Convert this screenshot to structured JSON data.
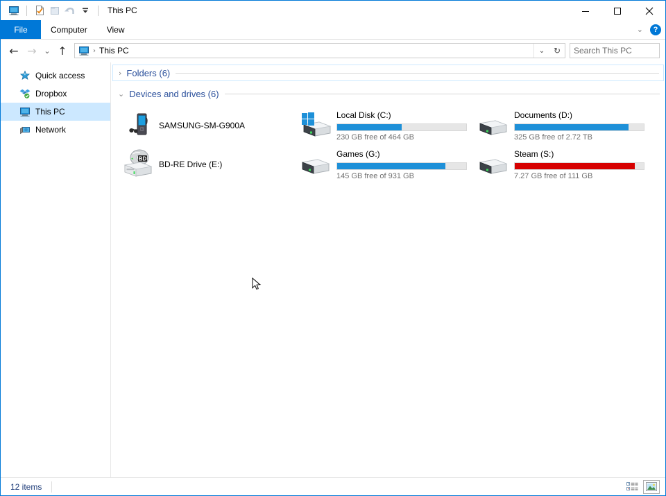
{
  "window": {
    "title": "This PC",
    "quick_access_toolbar": [
      {
        "name": "this-pc-icon",
        "enabled": true
      },
      {
        "name": "properties-icon",
        "enabled": true
      },
      {
        "name": "new-folder-icon",
        "enabled": false
      },
      {
        "name": "undo-icon",
        "enabled": false
      },
      {
        "name": "customize-chevron-icon",
        "enabled": true
      }
    ],
    "caption": {
      "minimize": "—",
      "maximize": "☐",
      "close": "✕"
    }
  },
  "ribbon": {
    "tabs": [
      {
        "label": "File",
        "active": true
      },
      {
        "label": "Computer",
        "active": false
      },
      {
        "label": "View",
        "active": false
      }
    ],
    "collapse_chevron": "⌄",
    "help_label": "?"
  },
  "address": {
    "back_glyph": "←",
    "forward_glyph": "→",
    "recent_glyph": "⌄",
    "up_glyph": "↑",
    "breadcrumb_icon": "this-pc-icon",
    "breadcrumb_separator": "›",
    "breadcrumb_label": "This PC",
    "dropdown_glyph": "⌄",
    "refresh_glyph": "↻"
  },
  "search": {
    "value": "",
    "placeholder": "Search This PC"
  },
  "sidebar": {
    "items": [
      {
        "label": "Quick access",
        "icon": "star-icon",
        "selected": false
      },
      {
        "label": "Dropbox",
        "icon": "dropbox-icon",
        "selected": false
      },
      {
        "label": "This PC",
        "icon": "this-pc-icon",
        "selected": true
      },
      {
        "label": "Network",
        "icon": "network-icon",
        "selected": false
      }
    ]
  },
  "content": {
    "groups": [
      {
        "label": "Folders (6)",
        "expanded": false,
        "chevron": "›",
        "focused": true,
        "items": []
      },
      {
        "label": "Devices and drives (6)",
        "expanded": true,
        "chevron": "⌄",
        "focused": false,
        "items": [
          {
            "name": "SAMSUNG-SM-G900A",
            "icon": "portable-media-player-icon",
            "has_bar": false,
            "bar_percent": 0,
            "bar_color": "",
            "free_text": ""
          },
          {
            "name": "Local Disk (C:)",
            "icon": "system-drive-icon",
            "has_bar": true,
            "bar_percent": 50,
            "bar_color": "#1e90d8",
            "free_text": "230 GB free of 464 GB"
          },
          {
            "name": "Documents (D:)",
            "icon": "drive-icon",
            "has_bar": true,
            "bar_percent": 88,
            "bar_color": "#1e90d8",
            "free_text": "325 GB free of 2.72 TB"
          },
          {
            "name": "BD-RE Drive (E:)",
            "icon": "optical-drive-icon",
            "has_bar": false,
            "bar_percent": 0,
            "bar_color": "",
            "free_text": ""
          },
          {
            "name": "Games (G:)",
            "icon": "drive-icon",
            "has_bar": true,
            "bar_percent": 84,
            "bar_color": "#1e90d8",
            "free_text": "145 GB free of 931 GB"
          },
          {
            "name": "Steam (S:)",
            "icon": "drive-icon",
            "has_bar": true,
            "bar_percent": 93,
            "bar_color": "#d60000",
            "free_text": "7.27 GB free of 111 GB"
          }
        ]
      }
    ]
  },
  "statusbar": {
    "item_count": "12 items",
    "views": [
      {
        "name": "details-view-button",
        "active": false
      },
      {
        "name": "large-icons-view-button",
        "active": true
      }
    ]
  }
}
